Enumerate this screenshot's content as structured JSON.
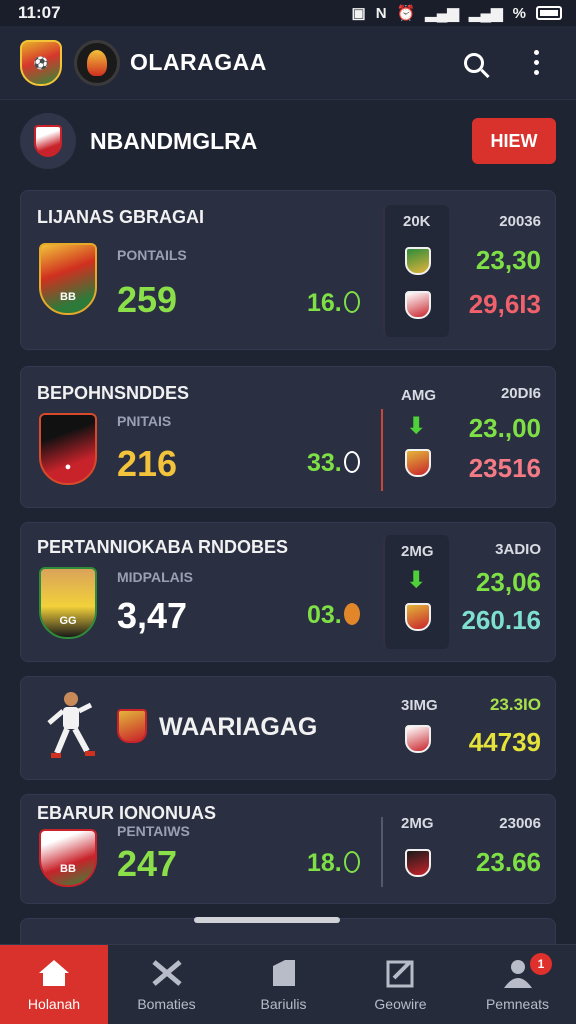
{
  "status_bar": {
    "time": "11:07",
    "battery_text": "%"
  },
  "app_bar": {
    "title": "OLARAGAA",
    "icons": [
      "crest-logo",
      "flame-logo",
      "search-icon",
      "more-vert-icon"
    ]
  },
  "team_header": {
    "title": "NBANDMGLRA",
    "view_button": "HIEW"
  },
  "cards": [
    {
      "name": "LIJANAS GBRAGAI",
      "points_label": "PONTAILS",
      "score": "259",
      "score_color": "#8be04a",
      "mid_stat": "16.",
      "col_label": "20K",
      "right_label": "20036",
      "right_top": "23,30",
      "right_top_color": "#7fe046",
      "right_bottom": "29,6I3",
      "right_bottom_color": "#f1616b"
    },
    {
      "name": "BEPOHNSNDDES",
      "points_label": "PNITAIS",
      "score": "216",
      "score_color": "#f3c33b",
      "mid_stat": "33.",
      "col_label": "AMG",
      "right_label": "20DI6",
      "right_top": "23.,00",
      "right_top_color": "#7fe046",
      "right_bottom": "23516",
      "right_bottom_color": "#f47a86"
    },
    {
      "name": "PERTANNIOKABA RNDOBES",
      "points_label": "MIDPALAIS",
      "score": "3,47",
      "score_color": "#ffffff",
      "mid_stat": "03.",
      "col_label": "2MG",
      "right_label": "3ADIO",
      "right_top": "23,06",
      "right_top_color": "#7fe046",
      "right_bottom": "260.16",
      "right_bottom_color": "#7fe0d0"
    },
    {
      "name": "WAARIAGAG",
      "col_label": "3IMG",
      "right_top": "23.3IO",
      "right_top_color": "#a7e04a",
      "right_bottom": "44739",
      "right_bottom_color": "#e5e23a"
    },
    {
      "name": "EBARUR IONONUAS",
      "points_label": "PENTAIWS",
      "score": "247",
      "score_color": "#8be04a",
      "mid_stat": "18.",
      "col_label": "2MG",
      "right_label": "23006",
      "right_top": "23.66",
      "right_top_color": "#7fe046"
    }
  ],
  "bottom_nav": [
    {
      "label": "Holanah",
      "icon": "home-icon",
      "active": true
    },
    {
      "label": "Bomaties",
      "icon": "tools-icon",
      "active": false
    },
    {
      "label": "Bariulis",
      "icon": "tag-icon",
      "active": false
    },
    {
      "label": "Geowire",
      "icon": "edit-icon",
      "active": false
    },
    {
      "label": "Pemneats",
      "icon": "people-icon",
      "active": false,
      "badge": "1"
    }
  ],
  "colors": {
    "accent": "#d9312c",
    "background": "#1f2433",
    "card": "#2a3042"
  }
}
